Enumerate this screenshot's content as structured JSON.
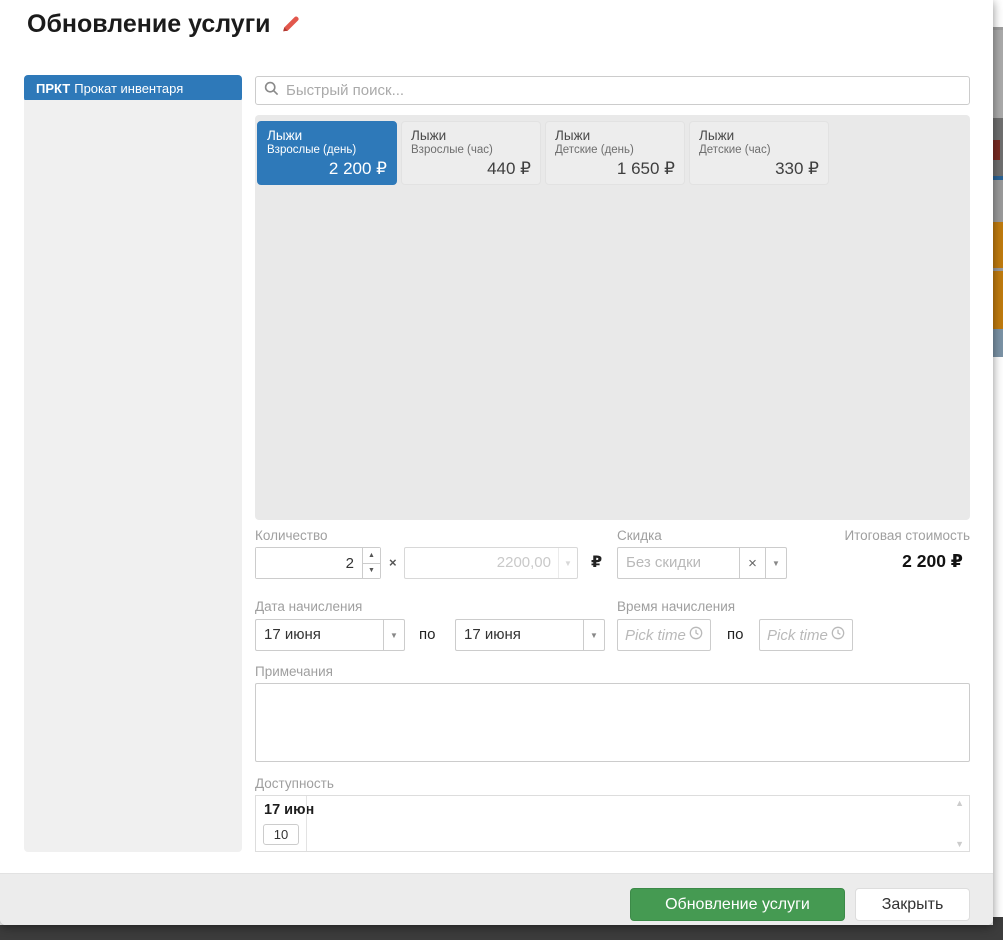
{
  "dialog": {
    "title": "Обновление услуги"
  },
  "sidebar": {
    "category": {
      "code": "ПРКТ",
      "name": "Прокат инвентаря"
    }
  },
  "search": {
    "placeholder": "Быстрый поиск..."
  },
  "services": [
    {
      "name": "Лыжи",
      "variant": "Взрослые (день)",
      "price": "2 200 ₽",
      "selected": true
    },
    {
      "name": "Лыжи",
      "variant": "Взрослые (час)",
      "price": "440 ₽",
      "selected": false
    },
    {
      "name": "Лыжи",
      "variant": "Детские (день)",
      "price": "1 650 ₽",
      "selected": false
    },
    {
      "name": "Лыжи",
      "variant": "Детские (час)",
      "price": "330 ₽",
      "selected": false
    }
  ],
  "pricing": {
    "quantity_label": "Количество",
    "quantity_value": "2",
    "multiply_sign": "×",
    "unit_price_value": "2200,00",
    "currency_sign": "₽",
    "discount_label": "Скидка",
    "discount_placeholder": "Без скидки",
    "clear_sign": "×",
    "total_label": "Итоговая стоимость",
    "total_value": "2 200 ₽"
  },
  "schedule": {
    "date_label": "Дата начисления",
    "date_from": "17 июня",
    "date_to": "17 июня",
    "between_text": "по",
    "time_label": "Время начисления",
    "time_from_placeholder": "Pick time",
    "time_to_placeholder": "Pick time",
    "time_between_text": "по"
  },
  "notes": {
    "label": "Примечания",
    "value": ""
  },
  "availability": {
    "label": "Доступность",
    "date": "17 июн",
    "count": "10"
  },
  "footer": {
    "submit_label": "Обновление услуги",
    "close_label": "Закрыть"
  },
  "colors": {
    "accent_blue": "#2e79b9",
    "success_green": "#459a52",
    "backdrop_dark": "#3c3c3c",
    "panel_gray": "#e9e9e9"
  }
}
